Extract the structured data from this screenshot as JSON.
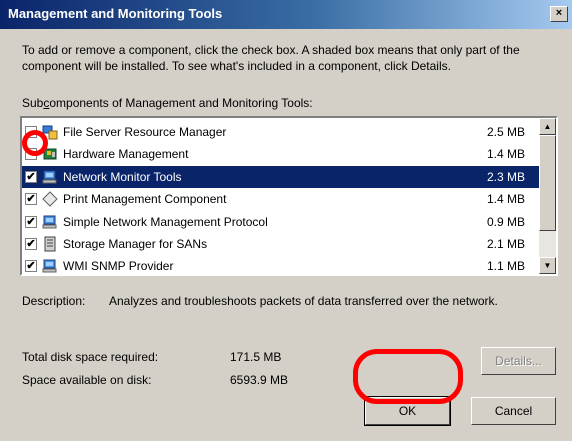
{
  "window": {
    "title": "Management and Monitoring Tools",
    "close_glyph": "×"
  },
  "intro_text": "To add or remove a component, click the check box. A shaded box means that only part of the component will be installed. To see what's included in a component, click Details.",
  "subcomponents": {
    "label_prefix": "Sub",
    "label_underlined": "c",
    "label_rest": "omponents of Management and Monitoring Tools:",
    "items": [
      {
        "name": "File Server Resource Manager",
        "size": "2.5 MB",
        "checked": false,
        "selected": false,
        "icon": "file-server-icon"
      },
      {
        "name": "Hardware Management",
        "size": "1.4 MB",
        "checked": false,
        "selected": false,
        "icon": "hardware-board-icon"
      },
      {
        "name": "Network Monitor Tools",
        "size": "2.3 MB",
        "checked": true,
        "selected": true,
        "icon": "network-computer-icon"
      },
      {
        "name": "Print Management Component",
        "size": "1.4 MB",
        "checked": true,
        "selected": false,
        "icon": "diamond-icon"
      },
      {
        "name": "Simple Network Management Protocol",
        "size": "0.9 MB",
        "checked": true,
        "selected": false,
        "icon": "network-computer-icon"
      },
      {
        "name": "Storage Manager for SANs",
        "size": "2.1 MB",
        "checked": true,
        "selected": false,
        "icon": "storage-icon"
      },
      {
        "name": "WMI SNMP Provider",
        "size": "1.1 MB",
        "checked": true,
        "selected": false,
        "icon": "network-computer-icon"
      }
    ]
  },
  "description": {
    "label": "Description:",
    "text": "Analyzes and troubleshoots packets of data transferred over the network."
  },
  "disk": {
    "required_label": "Total disk space required:",
    "required_value": "171.5 MB",
    "available_label": "Space available on disk:",
    "available_value": "6593.9 MB"
  },
  "buttons": {
    "details": "Details...",
    "ok": "OK",
    "cancel": "Cancel"
  },
  "colors": {
    "selection": "#0a246a",
    "annotation": "#ff0000"
  }
}
